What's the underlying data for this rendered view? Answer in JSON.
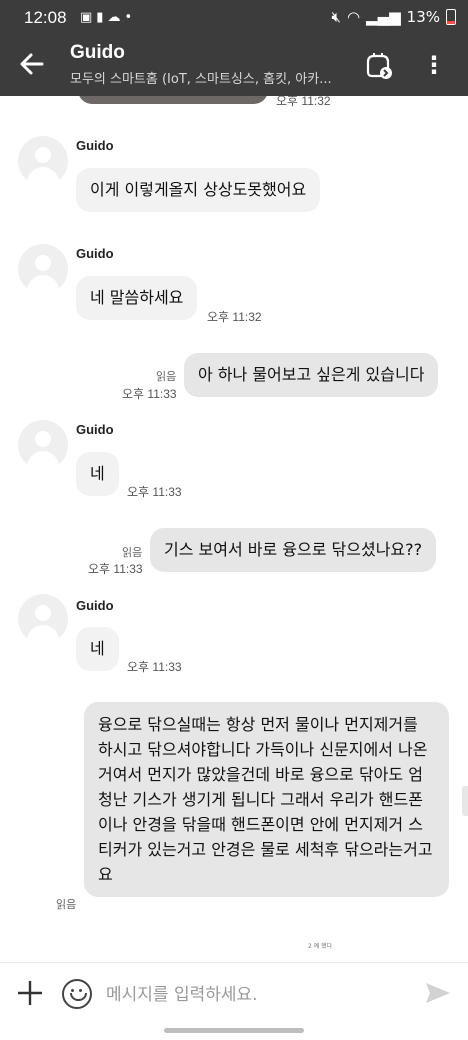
{
  "status_bar": {
    "time": "12:08",
    "left_icons": [
      "gallery-icon",
      "alert-icon",
      "cloud-icon",
      "dot-icon"
    ],
    "right_icons": [
      "mute-icon",
      "wifi-icon",
      "signal-icon",
      "battery-icon"
    ],
    "battery": "13%"
  },
  "header": {
    "title": "Guido",
    "subtitle": "모두의 스마트홈 (IoT, 스마트싱스, 홈킷, 아카...",
    "colors": {
      "bar": "#3c3c3c",
      "text": "#ffffff"
    }
  },
  "chat": {
    "top_time": "오후 11:32",
    "messages": [
      {
        "from": "Guido",
        "text": "이게 이렇게올지 상상도못했어요"
      },
      {
        "from": "Guido",
        "text": "네 말씀하세요",
        "time": "오후 11:32"
      },
      {
        "from": "me",
        "text": "아 하나 물어보고 싶은게 있습니다",
        "read": "읽음",
        "time": "오후 11:33"
      },
      {
        "from": "Guido",
        "text": "네",
        "time": "오후 11:33"
      },
      {
        "from": "me",
        "text": "기스 보여서 바로 융으로 닦으셨나요??",
        "read": "읽음",
        "time": "오후 11:33"
      },
      {
        "from": "Guido",
        "text": "네",
        "time": "오후 11:33"
      },
      {
        "from": "me",
        "text": "융으로 닦으실때는 항상 먼저 물이나 먼지제거를 하시고 닦으셔야합니다 가득이나 신문지에서 나온 거여서 먼지가 많았을건데 바로 융으로 닦아도 엄청난 기스가 생기게 됩니다 그래서 우리가 핸드폰이나 안경을 닦을때 핸드폰이면 안에 먼지제거 스티커가 있는거고 안경은 물로 세척후 닦으라는거고요",
        "read": "읽음"
      }
    ],
    "small_note": "2 예 했다"
  },
  "composer": {
    "placeholder": "메시지를 입력하세요."
  }
}
